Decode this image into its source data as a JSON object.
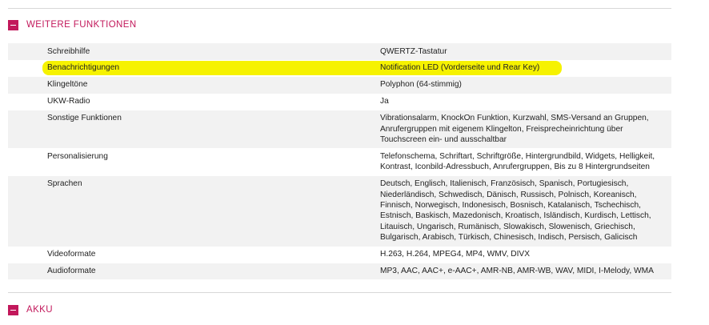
{
  "sections": {
    "weitere": {
      "title": "WEITERE FUNKTIONEN",
      "toggle_icon": "minus-icon"
    },
    "akku": {
      "title": "AKKU",
      "toggle_icon": "minus-icon"
    }
  },
  "colors": {
    "accent": "#c2185b",
    "row_shade": "#f2f2f2",
    "highlight": "#f6f200"
  },
  "rows": [
    {
      "label": "Schreibhilfe",
      "value": "QWERTZ-Tastatur"
    },
    {
      "label": "Benachrichtigungen",
      "value": "Notification LED (Vorderseite und Rear Key)",
      "highlighted": true
    },
    {
      "label": "Klingeltöne",
      "value": "Polyphon (64-stimmig)"
    },
    {
      "label": "UKW-Radio",
      "value": "Ja"
    },
    {
      "label": "Sonstige Funktionen",
      "value_lines": [
        "Vibrationsalarm, KnockOn Funktion, Kurzwahl, SMS-Versand an Gruppen,",
        "Anrufergruppen mit eigenem Klingelton, Freisprecheinrichtung über",
        "Touchscreen ein- und ausschaltbar"
      ]
    },
    {
      "label": "Personalisierung",
      "value_lines": [
        "Telefonschema, Schriftart, Schriftgröße, Hintergrundbild, Widgets, Helligkeit,",
        "Kontrast, Iconbild-Adressbuch, Anrufergruppen, Bis zu 8 Hintergrundseiten"
      ]
    },
    {
      "label": "Sprachen",
      "value_lines": [
        "Deutsch, Englisch, Italienisch, Französisch, Spanisch, Portugiesisch,",
        "Niederländisch, Schwedisch, Dänisch, Russisch, Polnisch, Koreanisch,",
        "Finnisch, Norwegisch, Indonesisch, Bosnisch, Katalanisch, Tschechisch,",
        "Estnisch, Baskisch, Mazedonisch, Kroatisch, Isländisch, Kurdisch, Lettisch,",
        "Litauisch, Ungarisch, Rumänisch, Slowakisch, Slowenisch, Griechisch,",
        "Bulgarisch, Arabisch, Türkisch, Chinesisch, Indisch, Persisch, Galicisch"
      ]
    },
    {
      "label": "Videoformate",
      "value": "H.263, H.264, MPEG4, MP4, WMV, DIVX"
    },
    {
      "label": "Audioformate",
      "value": "MP3, AAC, AAC+, e-AAC+, AMR-NB, AMR-WB, WAV, MIDI, I-Melody, WMA"
    }
  ]
}
